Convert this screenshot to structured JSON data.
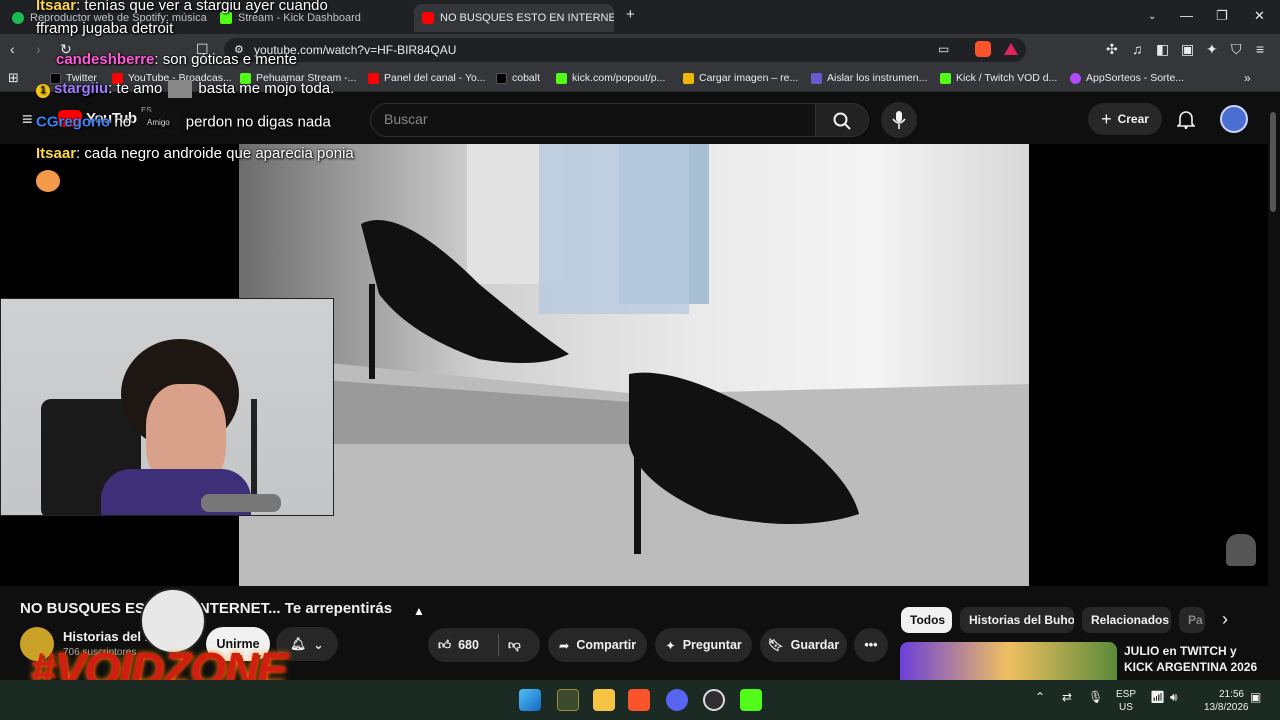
{
  "browser": {
    "tabs": [
      {
        "label": "Reproductor web de Spotify: música",
        "icon": "spotify-icon",
        "color": "#1db954"
      },
      {
        "label": "Stream - Kick Dashboard",
        "icon": "kick-icon",
        "color": "#53fc18"
      },
      {
        "label": "NO BUSQUES ESTO EN INTERNE",
        "icon": "youtube-icon",
        "color": "#ff0000",
        "active": true
      }
    ],
    "url": "youtube.com/watch?v=HF-BIR84QAU",
    "bookmarks": [
      {
        "label": "Twitter",
        "color": "#000000"
      },
      {
        "label": "YouTube - Broadcas...",
        "color": "#ff0000"
      },
      {
        "label": "Pehuamar Stream -...",
        "color": "#53fc18"
      },
      {
        "label": "Panel del canal - Yo...",
        "color": "#ff0000"
      },
      {
        "label": "cobalt",
        "color": "#000000"
      },
      {
        "label": "kick.com/popout/p...",
        "color": "#53fc18"
      },
      {
        "label": "Cargar imagen – re...",
        "color": "#f2b705"
      },
      {
        "label": "Aislar los instrumen...",
        "color": "#6a5acd"
      },
      {
        "label": "Kick / Twitch VOD d...",
        "color": "#53fc18"
      },
      {
        "label": "AppSorteos - Sorte...",
        "color": "#b04cff"
      }
    ]
  },
  "youtube": {
    "logo_label": "YouTube",
    "country": "ES",
    "search_placeholder": "Buscar",
    "create_label": "Crear",
    "video_title": "NO BUSQUES ESTO EN INTERNET... Te arrepentirás",
    "channel_name": "Historias del Buho",
    "subscribers": "706 suscriptores",
    "join_label": "Unirme",
    "likes": "680",
    "share_label": "Compartir",
    "ask_label": "Preguntar",
    "save_label": "Guardar",
    "chips": [
      "Todos",
      "Historias del Buho",
      "Relacionados",
      "Pa"
    ],
    "related_title": "JULIO en TWITCH y KICK ARGENTINA 2026"
  },
  "chat": [
    {
      "user": "Itsaar",
      "text": "tenías que ver a stargiu ayer cuando",
      "color": "#ffd54a"
    },
    {
      "user": "",
      "text": "fframp jugaba detroit",
      "color": "#ffffff"
    },
    {
      "user": "candeshberre",
      "text": "son góticas e mente",
      "color": "#ff5ad6"
    },
    {
      "user": "stargiiu",
      "text": "te amo",
      "color": "#9b7bff"
    },
    {
      "user": "",
      "text": "basta me mojo toda.",
      "color": "#ffffff"
    },
    {
      "user": "CGregorio",
      "text": "no",
      "color": "#3b82f6"
    },
    {
      "user": "Amigo",
      "text": "perdon no digas nada",
      "color": "#ffffff"
    },
    {
      "user": "Itsaar",
      "text": "cada negro androide que aparecia ponia",
      "color": "#ffd54a"
    }
  ],
  "overlay": {
    "brand": "#VOIDZONE"
  },
  "taskbar": {
    "lang": "ESP",
    "region": "US",
    "time": "21:56",
    "date": "13/8/2026"
  }
}
